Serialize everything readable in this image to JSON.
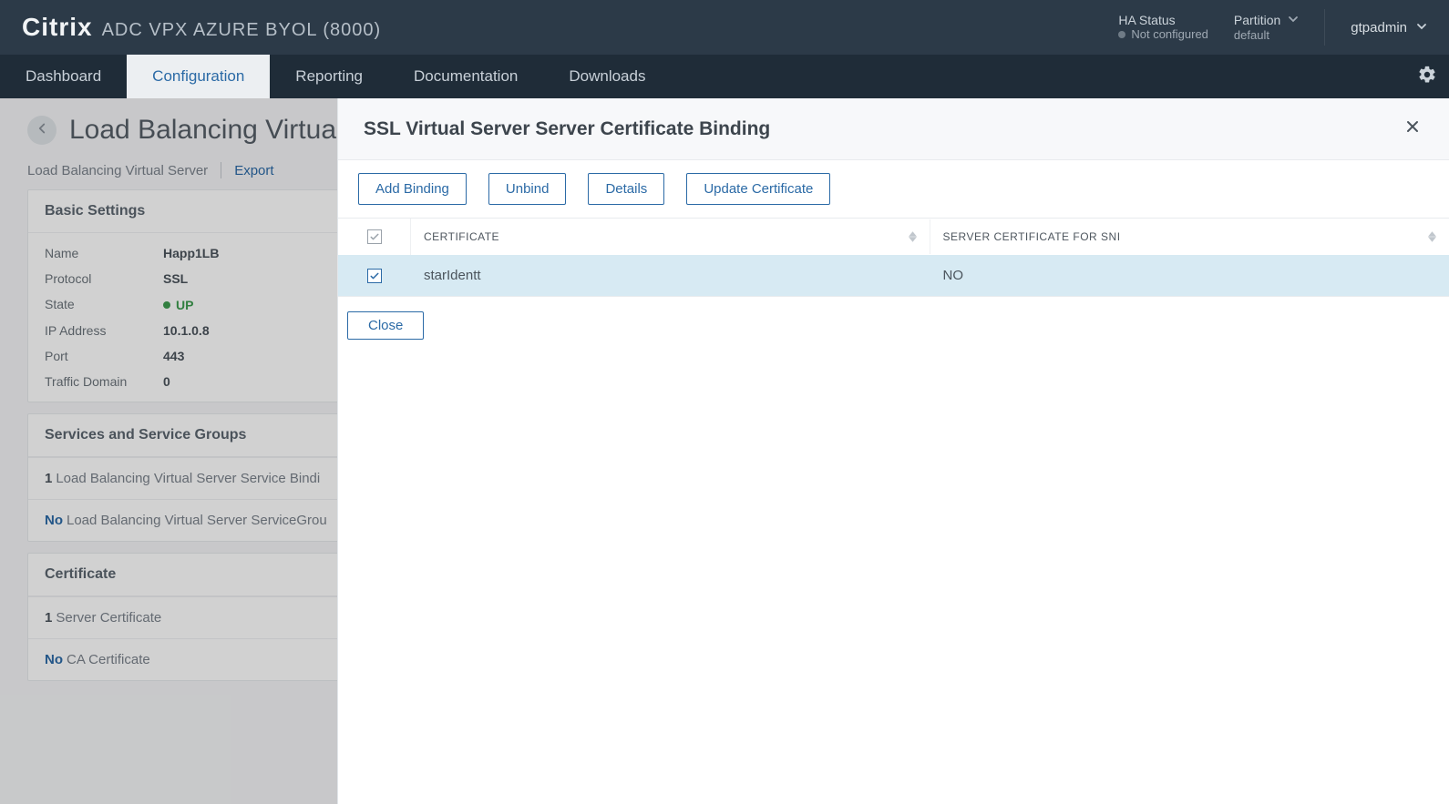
{
  "brand": {
    "logo": "Citrix",
    "product": "ADC VPX AZURE BYOL (8000)"
  },
  "topbar": {
    "ha_label": "HA Status",
    "ha_value": "Not configured",
    "partition_label": "Partition",
    "partition_value": "default",
    "user": "gtpadmin"
  },
  "nav": {
    "items": [
      "Dashboard",
      "Configuration",
      "Reporting",
      "Documentation",
      "Downloads"
    ],
    "active_index": 1
  },
  "page": {
    "title": "Load Balancing Virtual",
    "crumb": "Load Balancing Virtual Server",
    "crumb_action": "Export",
    "basic": {
      "header": "Basic Settings",
      "rows": {
        "name_l": "Name",
        "name_v": "Happ1LB",
        "proto_l": "Protocol",
        "proto_v": "SSL",
        "state_l": "State",
        "state_v": "UP",
        "ip_l": "IP Address",
        "ip_v": "10.1.0.8",
        "port_l": "Port",
        "port_v": "443",
        "td_l": "Traffic Domain",
        "td_v": "0"
      }
    },
    "services": {
      "header": "Services and Service Groups",
      "row1_count": "1",
      "row1_text": "Load Balancing Virtual Server Service Bindi",
      "row2_prefix": "No",
      "row2_text": "Load Balancing Virtual Server ServiceGrou"
    },
    "cert": {
      "header": "Certificate",
      "row1_count": "1",
      "row1_text": "Server Certificate",
      "row2_prefix": "No",
      "row2_text": "CA Certificate"
    }
  },
  "modal": {
    "title": "SSL Virtual Server Server Certificate Binding",
    "buttons": {
      "add": "Add Binding",
      "unbind": "Unbind",
      "details": "Details",
      "update": "Update Certificate",
      "close": "Close"
    },
    "columns": {
      "cert": "CERTIFICATE",
      "sni": "SERVER CERTIFICATE FOR SNI"
    },
    "rows": [
      {
        "certificate": "starIdentt",
        "sni": "NO",
        "selected": true
      }
    ]
  }
}
